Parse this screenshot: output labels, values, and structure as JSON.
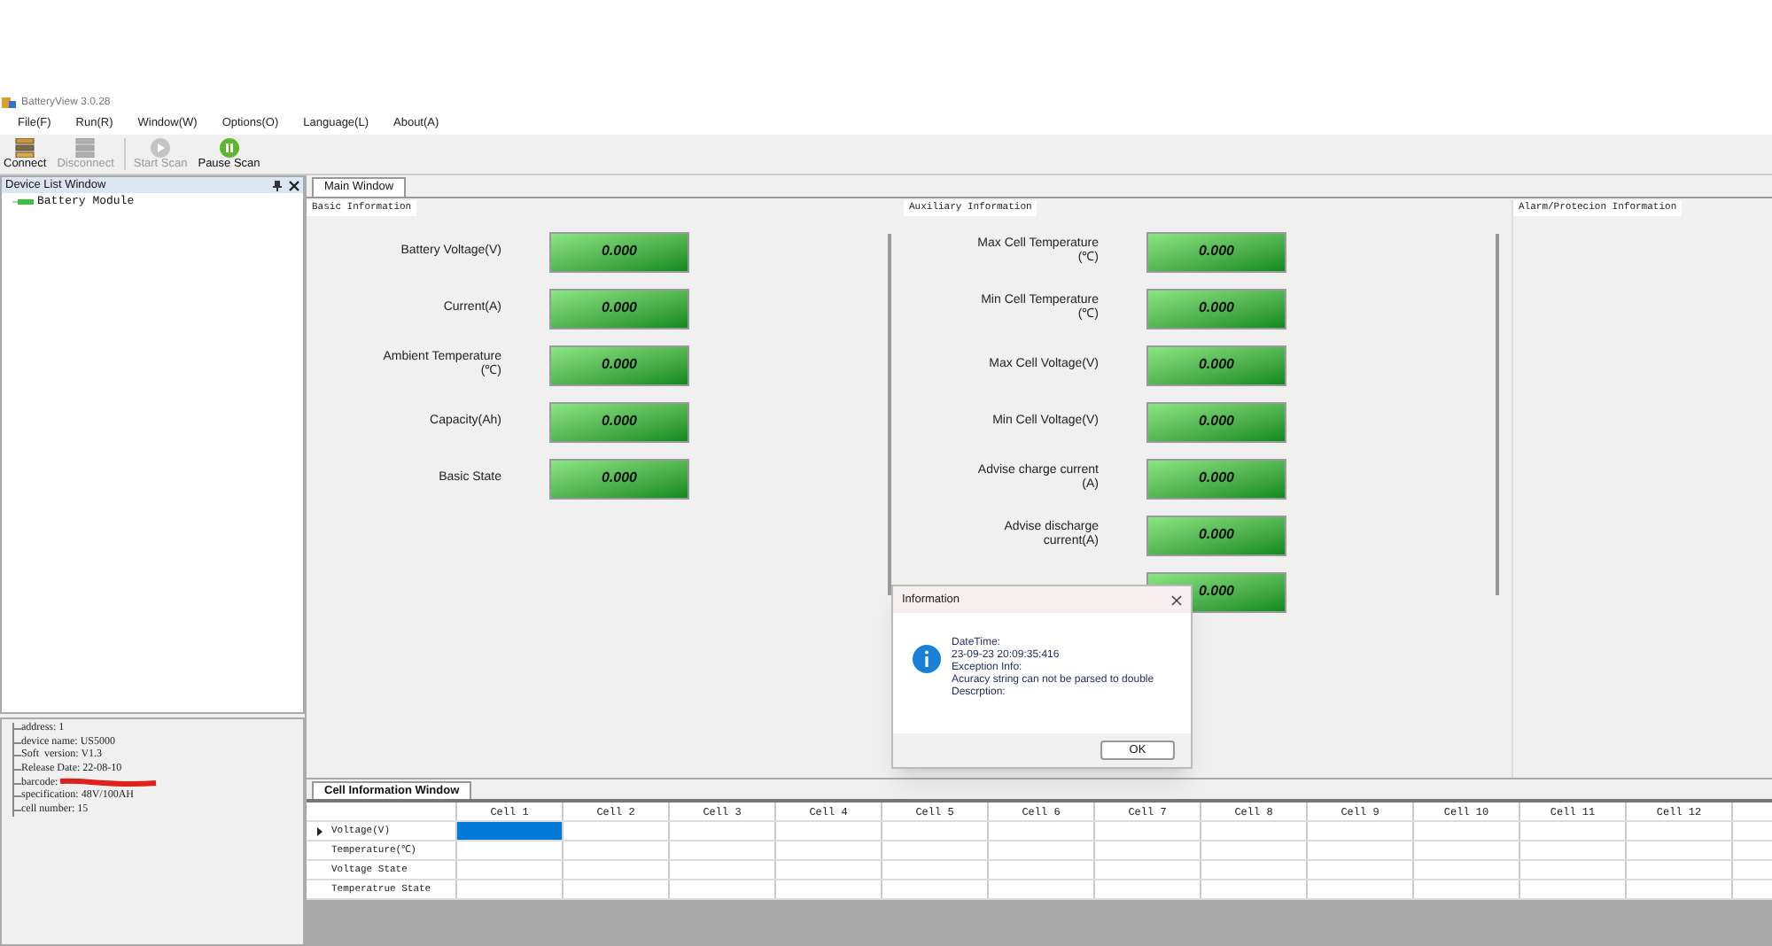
{
  "window": {
    "title": "BatteryView 3.0.28"
  },
  "menu": [
    "File(F)",
    "Run(R)",
    "Window(W)",
    "Options(O)",
    "Language(L)",
    "About(A)"
  ],
  "toolbar": [
    {
      "label": "Connect",
      "disabled": false,
      "kind": "connect"
    },
    {
      "label": "Disconnect",
      "disabled": true,
      "kind": "disconnect"
    },
    {
      "label": "Start Scan",
      "disabled": true,
      "kind": "start"
    },
    {
      "label": "Pause Scan",
      "disabled": false,
      "kind": "pause"
    }
  ],
  "device_list": {
    "title": "Device List Window",
    "items": [
      "Battery Module"
    ]
  },
  "device_info": [
    {
      "text": "address: 1",
      "redacted": false
    },
    {
      "text": "device name: US5000",
      "redacted": false
    },
    {
      "text": "Soft  version: V1.3",
      "redacted": false
    },
    {
      "text": "Release Date: 22-08-10",
      "redacted": false
    },
    {
      "text": "barcode:",
      "redacted": true
    },
    {
      "text": "specification: 48V/100AH",
      "redacted": false
    },
    {
      "text": "cell number: 15",
      "redacted": false
    }
  ],
  "main_window": {
    "tab": "Main Window",
    "basic": {
      "title": "Basic Information",
      "rows": [
        {
          "label": "Battery Voltage(V)",
          "value": "0.000"
        },
        {
          "label": "Current(A)",
          "value": "0.000"
        },
        {
          "label": "Ambient Temperature\n(℃)",
          "value": "0.000"
        },
        {
          "label": "Capacity(Ah)",
          "value": "0.000"
        },
        {
          "label": "Basic State",
          "value": "0.000"
        }
      ]
    },
    "auxiliary": {
      "title": "Auxiliary Information",
      "rows": [
        {
          "label": "Max Cell Temperature\n(℃)",
          "value": "0.000"
        },
        {
          "label": "Min Cell Temperature\n(℃)",
          "value": "0.000"
        },
        {
          "label": "Max Cell Voltage(V)",
          "value": "0.000"
        },
        {
          "label": "Min Cell Voltage(V)",
          "value": "0.000"
        },
        {
          "label": "Advise charge current\n(A)",
          "value": "0.000"
        },
        {
          "label": "Advise discharge\ncurrent(A)",
          "value": "0.000"
        },
        {
          "value": "0.000"
        }
      ]
    },
    "alarm": {
      "title": "Alarm/Protecion Information"
    }
  },
  "cell_window": {
    "tab": "Cell Information Window",
    "columns": [
      "Cell 1",
      "Cell 2",
      "Cell 3",
      "Cell 4",
      "Cell 5",
      "Cell 6",
      "Cell 7",
      "Cell 8",
      "Cell 9",
      "Cell 10",
      "Cell 11",
      "Cell 12"
    ],
    "rows": [
      {
        "label": "Voltage(V)",
        "current": true
      },
      {
        "label": "Temperature(℃)",
        "current": false
      },
      {
        "label": "Voltage State",
        "current": false
      },
      {
        "label": "Temperatrue State",
        "current": false
      }
    ]
  },
  "dialog": {
    "title": "Information",
    "lines": [
      "DateTime:",
      "23-09-23 20:09:35:416",
      "Exception Info:",
      "Acuracy string can not be parsed to double",
      "Descrption:"
    ],
    "button": "OK"
  }
}
